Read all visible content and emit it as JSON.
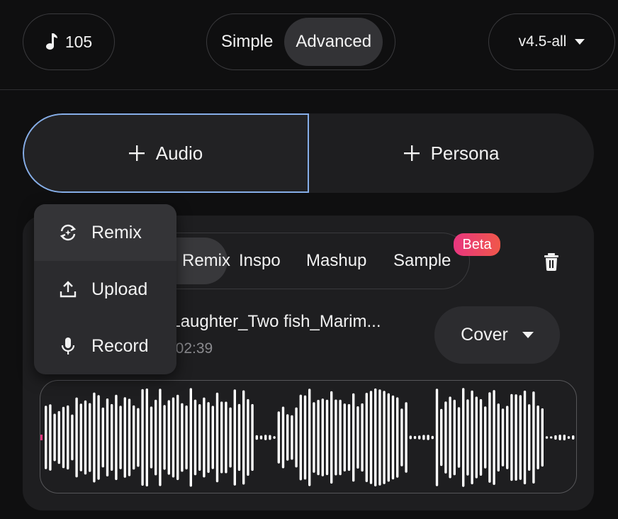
{
  "header": {
    "credits": "105",
    "modes": [
      "Simple",
      "Advanced"
    ],
    "active_mode": "Advanced",
    "version": "v4.5-all"
  },
  "add_bar": {
    "audio_label": "Audio",
    "persona_label": "Persona"
  },
  "tabs": [
    {
      "label": "Remix",
      "active": true
    },
    {
      "label": "Inspo",
      "active": false
    },
    {
      "label": "Mashup",
      "active": false
    },
    {
      "label": "Sample",
      "active": false
    }
  ],
  "beta_badge": "Beta",
  "track": {
    "title": "_Laughter_Two fish_Marim...",
    "time": "/ 02:39",
    "mode_select": "Cover"
  },
  "menu": [
    {
      "label": "Remix",
      "icon": "remix-icon"
    },
    {
      "label": "Upload",
      "icon": "upload-icon"
    },
    {
      "label": "Record",
      "icon": "mic-icon"
    }
  ],
  "colors": {
    "accent_border": "#86aee8",
    "beta_gradient_start": "#e8367f",
    "beta_gradient_end": "#f0574a",
    "playhead": "#e8367f"
  }
}
